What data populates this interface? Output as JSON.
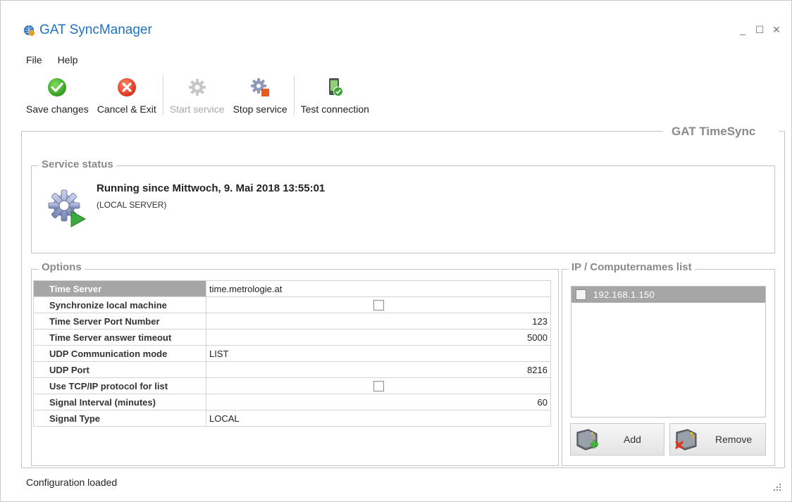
{
  "window": {
    "title": "GAT SyncManager",
    "controls": {
      "minimize": "_",
      "maximize": "☐",
      "close": "✕"
    }
  },
  "menu": {
    "items": [
      "File",
      "Help"
    ]
  },
  "toolbar": {
    "save_label": "Save changes",
    "cancel_label": "Cancel & Exit",
    "start_label": "Start service",
    "stop_label": "Stop service",
    "test_label": "Test connection"
  },
  "main": {
    "title": "GAT TimeSync",
    "service_status": {
      "title": "Service status",
      "line1": "Running since Mittwoch, 9. Mai 2018 13:55:01",
      "line2": "(LOCAL SERVER)"
    },
    "options": {
      "title": "Options",
      "rows": [
        {
          "key": "Time Server",
          "value": "time.metrologie.at"
        },
        {
          "key": "Synchronize local machine",
          "value": ""
        },
        {
          "key": "Time Server Port Number",
          "value": "123"
        },
        {
          "key": "Time Server answer timeout",
          "value": "5000"
        },
        {
          "key": "UDP Communication mode",
          "value": "LIST"
        },
        {
          "key": "UDP Port",
          "value": "8216"
        },
        {
          "key": "Use TCP/IP protocol for list",
          "value": ""
        },
        {
          "key": "Signal Interval (minutes)",
          "value": "60"
        },
        {
          "key": "Signal Type",
          "value": "LOCAL"
        }
      ]
    },
    "ip_list": {
      "title": "IP / Computernames list",
      "items": [
        "192.168.1.150"
      ],
      "add_label": "Add",
      "remove_label": "Remove"
    }
  },
  "statusbar": {
    "text": "Configuration loaded"
  },
  "colors": {
    "accent": "#1e73be",
    "selection": "#a6a6a6",
    "group_title": "#8a8a8a"
  }
}
